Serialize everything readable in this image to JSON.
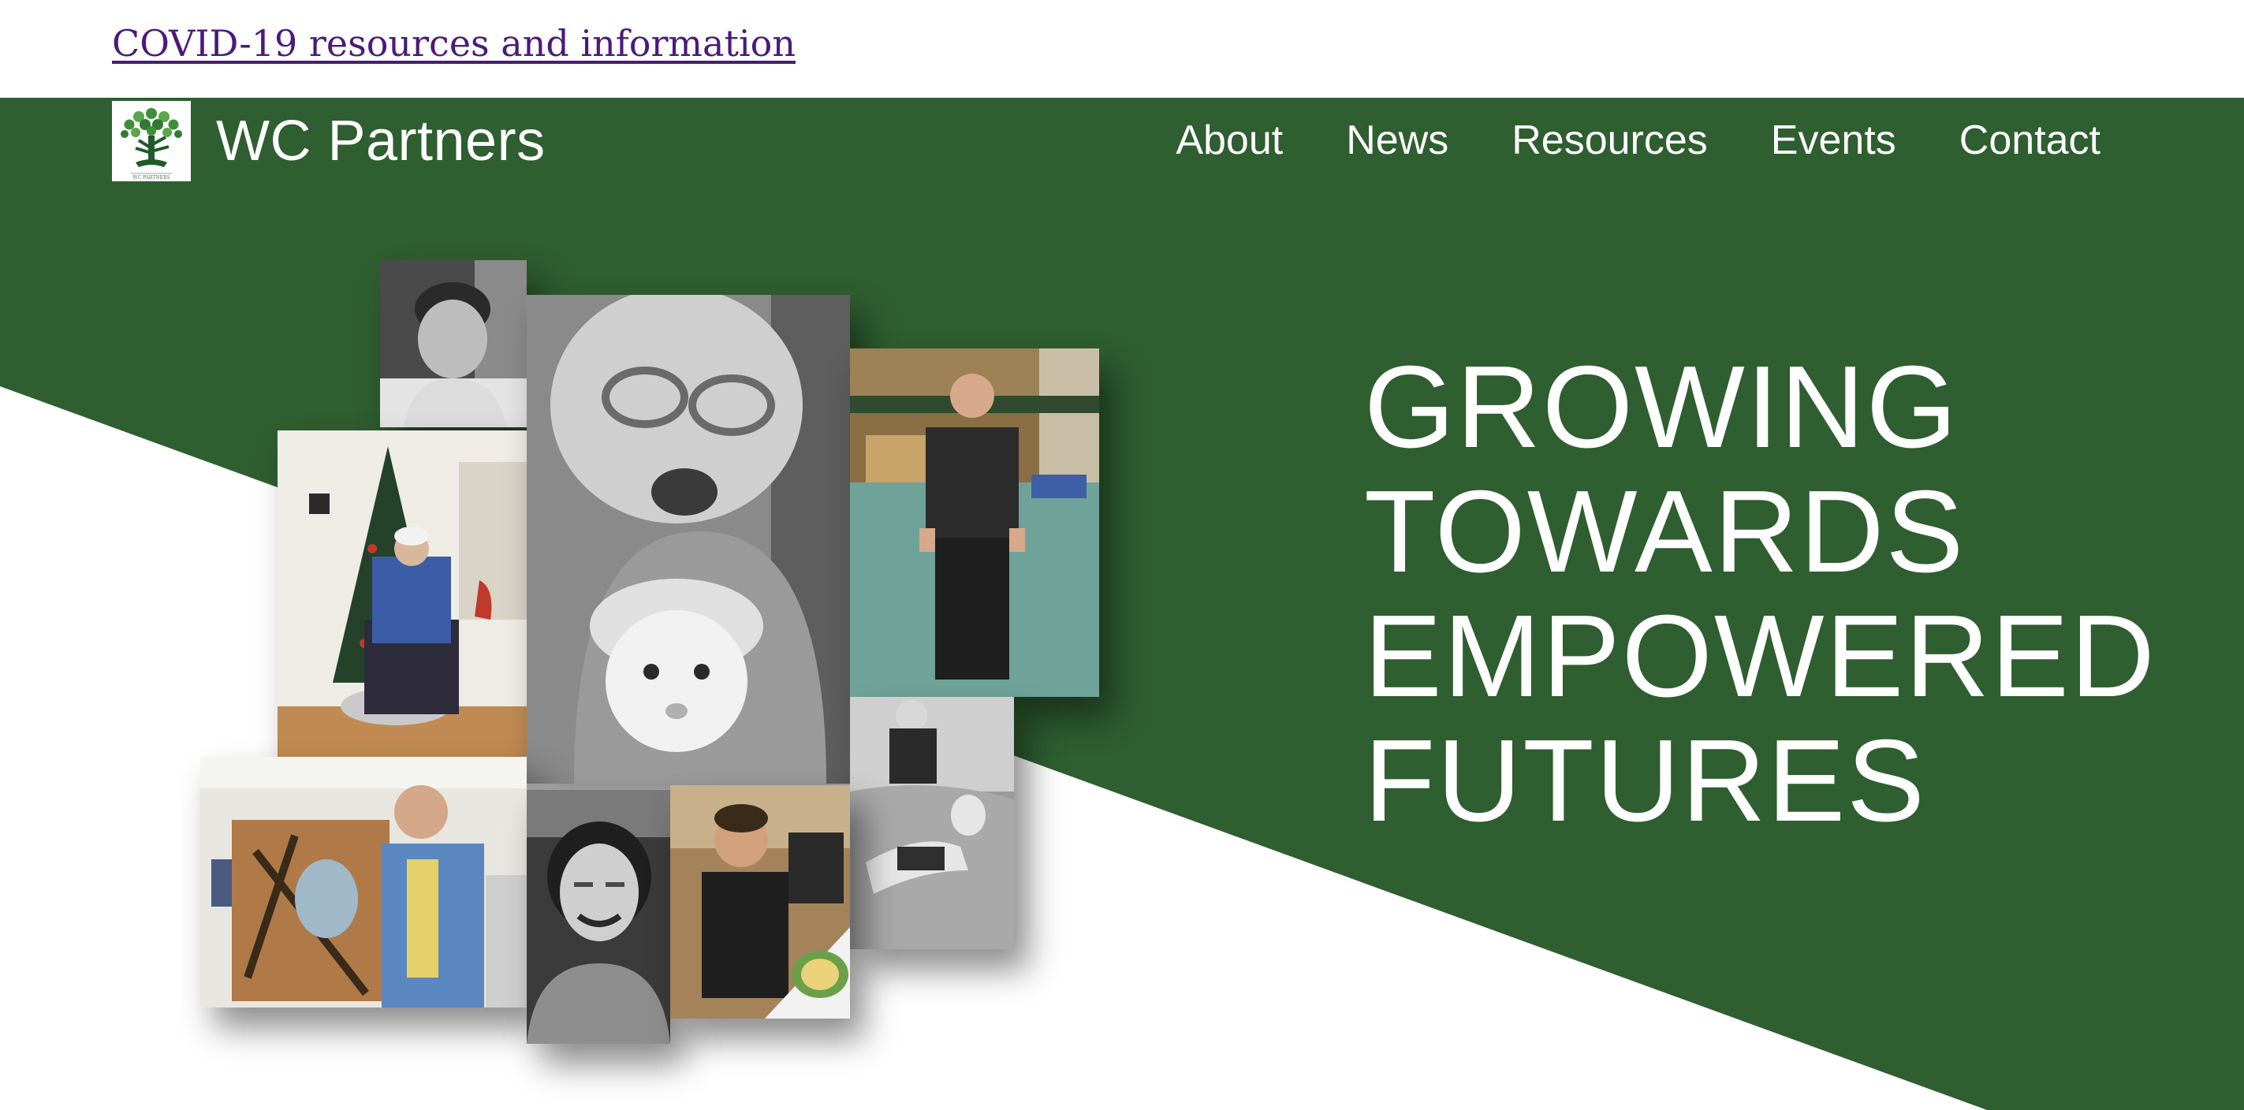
{
  "alert": {
    "link_text": "COVID-19 resources and information"
  },
  "header": {
    "site_name": "WC Partners",
    "logo_text": "WC PARTNERS",
    "nav": [
      {
        "label": "About"
      },
      {
        "label": "News"
      },
      {
        "label": "Resources"
      },
      {
        "label": "Events"
      },
      {
        "label": "Contact"
      }
    ]
  },
  "hero": {
    "tagline_lines": [
      "GROWING",
      "TOWARDS",
      "EMPOWERED",
      "FUTURES"
    ]
  },
  "colors": {
    "brand_green": "#2f5e30",
    "link_purple": "#4b1a7a",
    "text_white": "#ffffff"
  },
  "icons": {
    "logo": "tree-logo-icon"
  }
}
